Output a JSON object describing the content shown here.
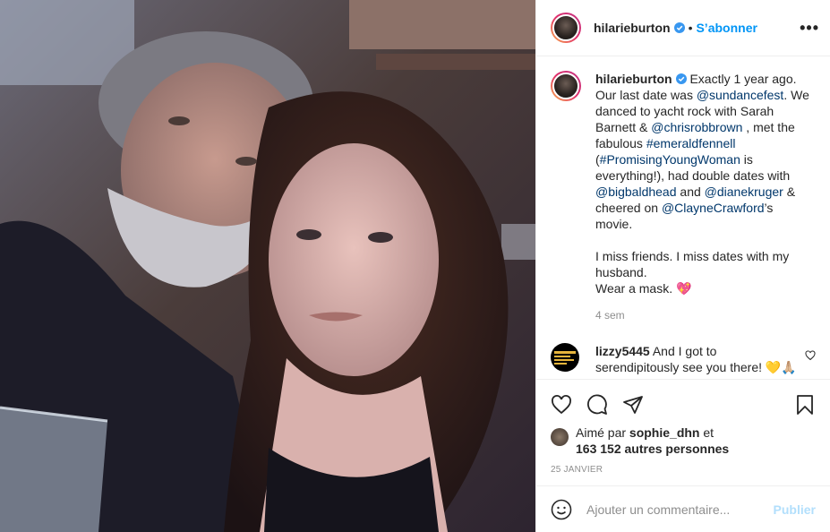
{
  "post": {
    "image_alt": "Selfie of a bearded man and a woman with long wavy hair"
  },
  "header": {
    "username": "hilarieburton",
    "separator": "•",
    "follow_label": "S’abonner",
    "more_label": "•••"
  },
  "caption": {
    "username": "hilarieburton",
    "segments": [
      {
        "t": " Exactly 1 year ago. Our last date was "
      },
      {
        "t": "@sundancefest",
        "link": true
      },
      {
        "t": ". We danced to yacht rock with Sarah Barnett & "
      },
      {
        "t": "@chrisrobbrown",
        "link": true
      },
      {
        "t": " , met the fabulous "
      },
      {
        "t": "#emeraldfennell",
        "link": true
      },
      {
        "t": " ("
      },
      {
        "t": "#PromisingYoungWoman",
        "link": true
      },
      {
        "t": " is everything!), had double dates with "
      },
      {
        "t": "@bigbaldhead",
        "link": true
      },
      {
        "t": " and "
      },
      {
        "t": "@dianekruger",
        "link": true
      },
      {
        "t": " & cheered on "
      },
      {
        "t": "@ClayneCrawford",
        "link": true
      },
      {
        "t": "’s movie."
      }
    ],
    "paragraph2_line1": "I miss friends. I miss dates with my husband.",
    "paragraph2_line2": "Wear a mask. 💖",
    "time": "4 sem"
  },
  "comments": [
    {
      "username": "lizzy5445",
      "text": " And I got to serendipitously see you there! 💛🙏🏼"
    }
  ],
  "actions": {
    "liked_by_prefix": "Aimé par ",
    "liked_by_user": "sophie_dhn",
    "liked_by_and": " et",
    "others": "163 152 autres personnes",
    "date": "25 JANVIER"
  },
  "add_comment": {
    "placeholder": "Ajouter un commentaire...",
    "publish_label": "Publier"
  },
  "colors": {
    "link": "#00376b",
    "follow": "#0095f6",
    "verified": "#3897f0",
    "publish_disabled": "#b2dffc"
  }
}
